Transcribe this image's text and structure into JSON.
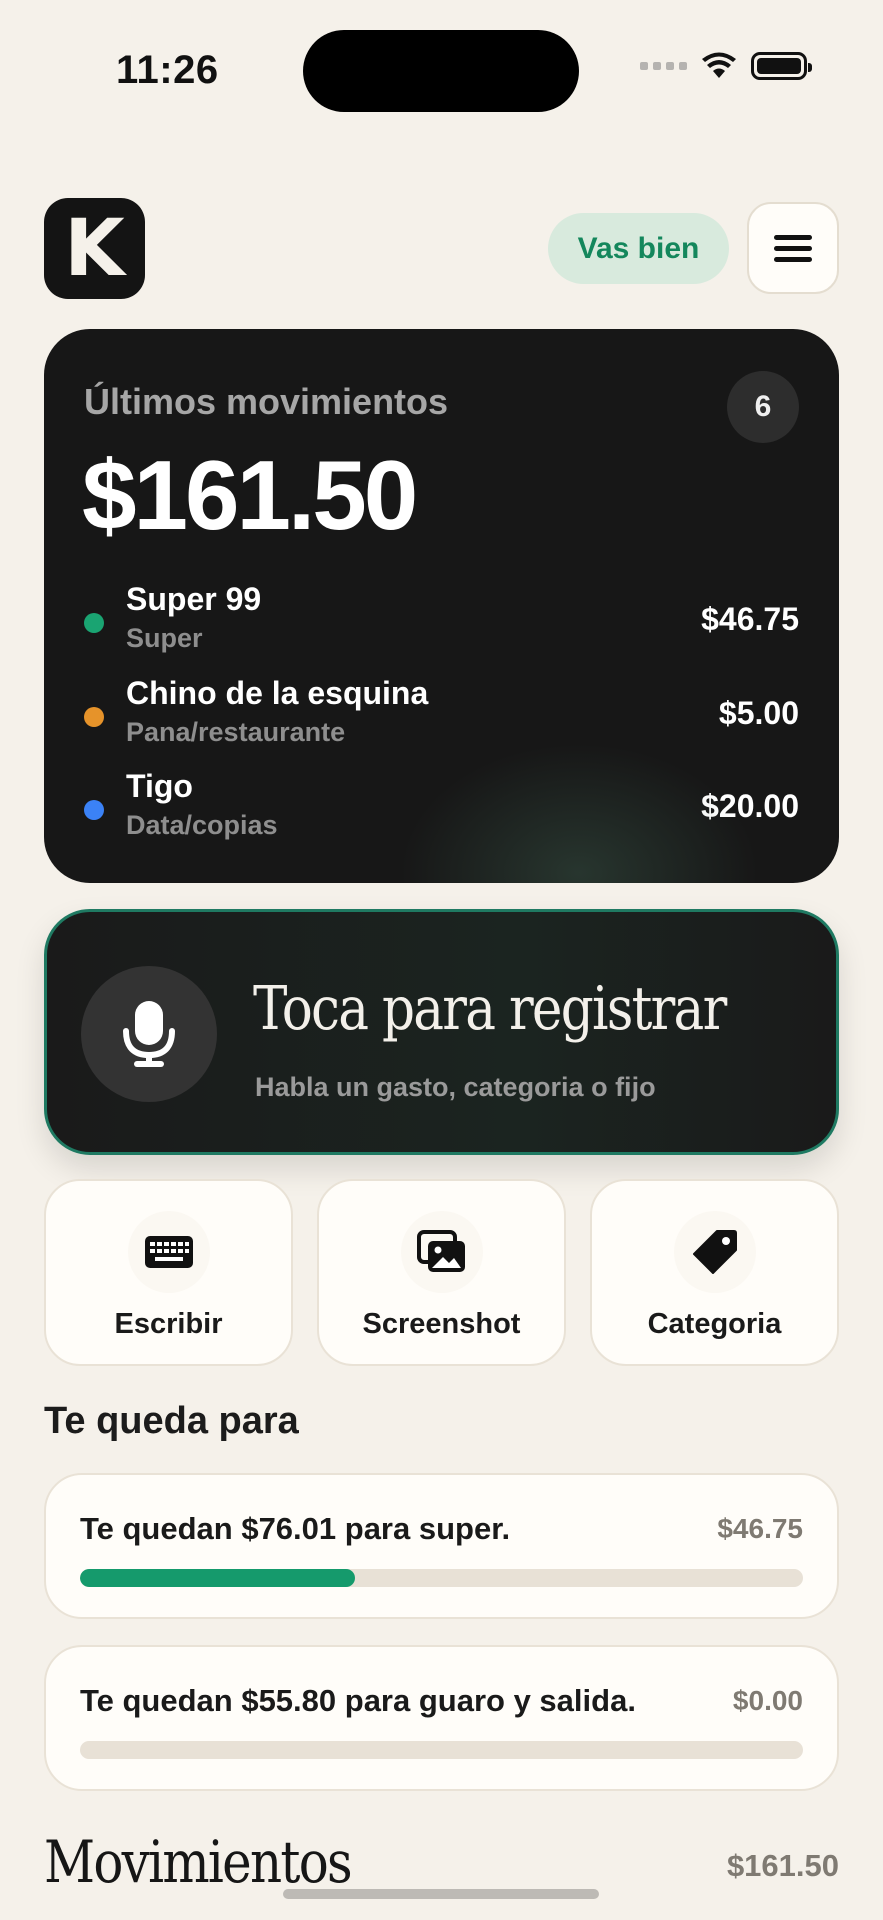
{
  "status_bar": {
    "time": "11:26"
  },
  "header": {
    "logo_letter": "K",
    "status_pill": "Vas bien"
  },
  "recent": {
    "title": "Últimos movimientos",
    "count": "6",
    "total": "$161.50",
    "items": [
      {
        "name": "Super 99",
        "category": "Super",
        "amount": "$46.75",
        "color": "#1aa472"
      },
      {
        "name": "Chino de la esquina",
        "category": "Pana/restaurante",
        "amount": "$5.00",
        "color": "#e6932a"
      },
      {
        "name": "Tigo",
        "category": "Data/copias",
        "amount": "$20.00",
        "color": "#3b82f6"
      }
    ]
  },
  "voice": {
    "title": "Toca para registrar",
    "subtitle": "Habla un gasto, categoria o fijo"
  },
  "actions": [
    {
      "label": "Escribir",
      "icon": "keyboard-icon"
    },
    {
      "label": "Screenshot",
      "icon": "images-icon"
    },
    {
      "label": "Categoria",
      "icon": "tag-icon"
    }
  ],
  "budgets": {
    "title": "Te queda para",
    "items": [
      {
        "text": "Te quedan $76.01 para super.",
        "spent": "$46.75",
        "progress_percent": 38
      },
      {
        "text": "Te quedan $55.80 para guaro y salida.",
        "spent": "$0.00",
        "progress_percent": 0
      }
    ]
  },
  "movements": {
    "title": "Movimientos",
    "total": "$161.50"
  }
}
